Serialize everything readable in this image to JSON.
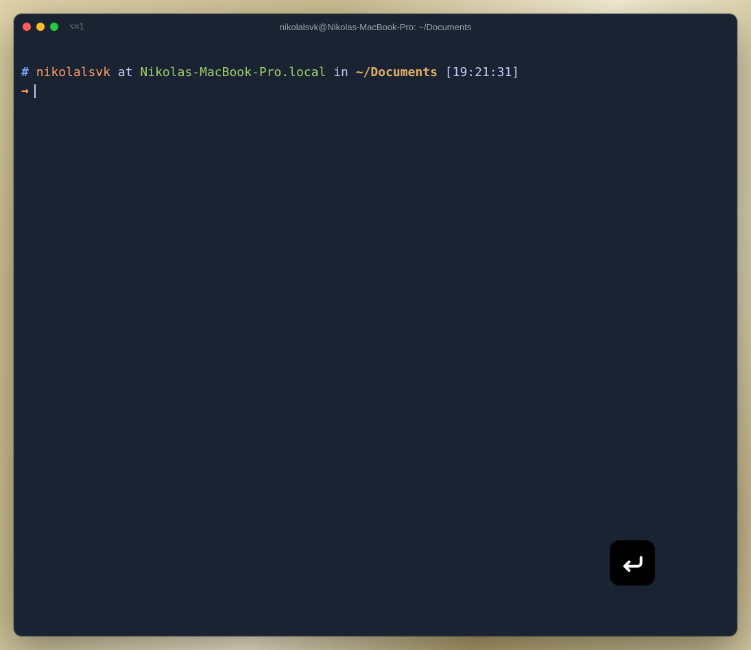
{
  "titlebar": {
    "title": "nikolalsvk@Nikolas-MacBook-Pro: ~/Documents",
    "tab_indicator": "⌥⌘1"
  },
  "prompt": {
    "hash": "#",
    "user": "nikolalsvk",
    "at_word": " at ",
    "host": "Nikolas-MacBook-Pro.local",
    "in_word": " in ",
    "path": "~/Documents",
    "time": " [19:21:31]",
    "arrow": "→"
  },
  "colors": {
    "bg": "#1a2332",
    "user": "#ff9e64",
    "host": "#9ece6a",
    "path": "#e0af68",
    "hash": "#7aa2f7",
    "text": "#c0caf5"
  }
}
